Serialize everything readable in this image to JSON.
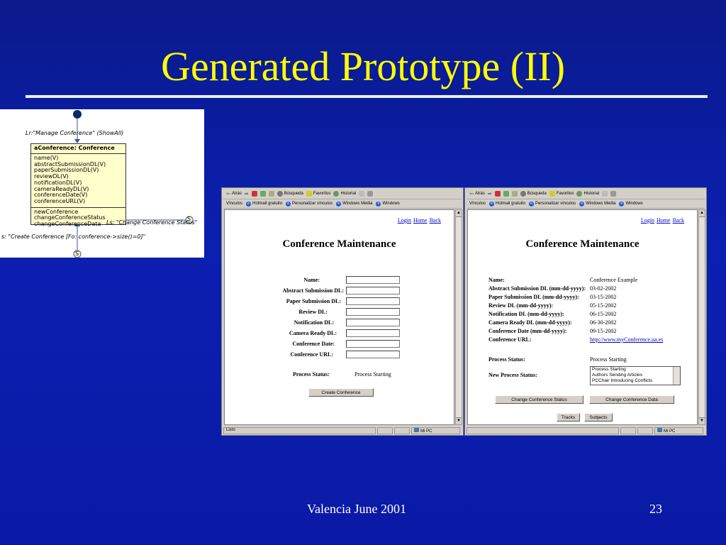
{
  "slide": {
    "title": "Generated Prototype (II)",
    "footer_left": "Valencia June 2001",
    "page_number": "23"
  },
  "uml": {
    "top_label": "Lr:\"Manage Conference\" (ShowAll)",
    "class_name": "aConference: Conference",
    "attributes": [
      "name(V)",
      "abstractSubmissionDL(V)",
      "paperSubmissionDL(V)",
      "reviewDL(V)",
      "notificationDL(V)",
      "cameraReadyDL(V)",
      "conferenceDate(V)",
      "conferenceURL(V)"
    ],
    "operations": [
      "newConference",
      "changeConferenceStatus",
      "changeConferenceData"
    ],
    "right_label": "Ls: \"Change Conference Status\"",
    "bottom_label": "s: \"Create Conference [Fo: conference->size()=0]\"",
    "state_marker": "S"
  },
  "browser": {
    "toolbar": [
      "Atrás",
      "Búsqueda",
      "Favoritos",
      "Historial"
    ],
    "links_label": "Vínculos",
    "links": [
      "Hotmail gratuito",
      "Personalizar vínculos",
      "Windows Media",
      "Windows"
    ],
    "status_left": "Listo",
    "status_right": "Mi PC",
    "nav_links": [
      "Login",
      "Home",
      "Back"
    ],
    "page_title": "Conference Maintenance"
  },
  "form_new": {
    "labels": [
      "Name:",
      "Abstract Submission DL:",
      "Paper Submission DL:",
      "Review DL:",
      "Notification DL:",
      "Camera Ready DL:",
      "Conference Date:",
      "Conference URL:"
    ],
    "process_status_label": "Process Status:",
    "process_status_value": "Process Starting",
    "create_button": "Create Conference"
  },
  "form_edit": {
    "rows": [
      {
        "label": "Name:",
        "value": "Conference Example"
      },
      {
        "label": "Abstract Submission DL (mm-dd-yyyy):",
        "value": "03-02-2002"
      },
      {
        "label": "Paper Submission DL (mm-dd-yyyy):",
        "value": "03-15-2002"
      },
      {
        "label": "Review DL (mm-dd-yyyy):",
        "value": "05-15-2002"
      },
      {
        "label": "Notification DL (mm-dd-yyyy):",
        "value": "06-15-2002"
      },
      {
        "label": "Camera Ready DL (mm-dd-yyyy):",
        "value": "06-30-2002"
      },
      {
        "label": "Conference Date (mm-dd-yyyy):",
        "value": "09-15-2002"
      },
      {
        "label": "Conference URL:",
        "value": "http://www.myConference.ua.es"
      }
    ],
    "process_status_label": "Process Status:",
    "process_status_value": "Process Starting",
    "new_status_label": "New Process Status:",
    "status_options": [
      "Process Starting",
      "Authors Sending Articles",
      "PCChair Introducing Conflicts"
    ],
    "change_status_button": "Change Conference Status",
    "change_data_button": "Change Conference Data",
    "tracks_button": "Tracks",
    "subjects_button": "Subjects"
  }
}
